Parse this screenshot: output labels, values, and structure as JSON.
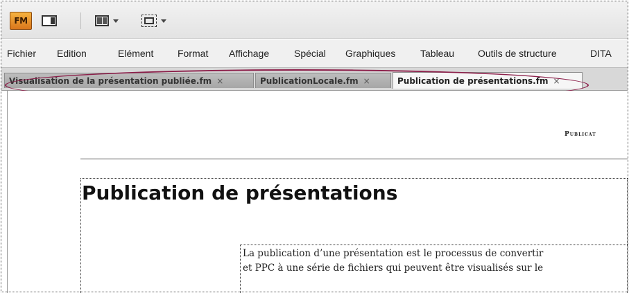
{
  "toolbar": {
    "logo_text": "FM",
    "icons": [
      "panel-toggle-icon",
      "layout-icon",
      "fit-window-icon"
    ]
  },
  "menu": {
    "items": [
      "Fichier",
      "Edition",
      "Elément",
      "Format",
      "Affichage",
      "Spécial",
      "Graphiques",
      "Tableau",
      "Outils de structure",
      "DITA"
    ]
  },
  "tabs": [
    {
      "label": "Visualisation de la présentation publiée.fm",
      "close": "×",
      "active": false
    },
    {
      "label": "PublicationLocale.fm",
      "close": "×",
      "active": false
    },
    {
      "label": "Publication de présentations.fm",
      "close": "×",
      "active": true
    }
  ],
  "document": {
    "running_header": "Publicat",
    "title": "Publication de présentations",
    "body_lines": [
      "La publication d’une présentation est le processus de convertir",
      "et PPC à une série de fichiers qui peuvent être visualisés sur le"
    ]
  },
  "colors": {
    "highlight_ellipse": "#8c1f4a",
    "logo_orange": "#e88a2a"
  }
}
